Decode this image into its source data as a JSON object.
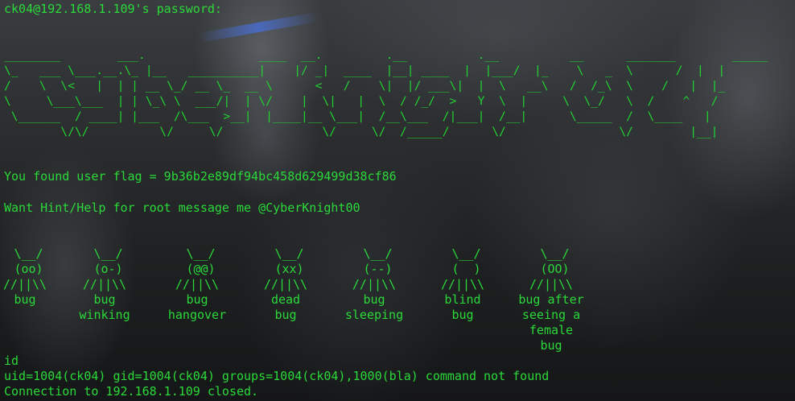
{
  "terminal": {
    "password_prompt": "ck04@192.168.1.109's password:",
    "ascii_banner": "________        ___.                ____  __.         .__          .__          __      _______        _____  \n\\_   ___ \\___.__.\\_ |__   __________|    |/ _|  ____  |__| ____  |  |___/  |_    \\   _  \\      /  |  | \n/    \\  \\<   |  | | __ \\_/ __ \\_  __ \\      <   /    \\|  |/ ___\\|  |  \\   __\\   /  /_\\  \\    /   |  |_\n\\     \\___\\___  | | \\_\\ \\  ___/|  | \\/    |  \\|   |  \\  / /_/  >   Y  \\  |     \\  \\_/   \\  /    ^   /\n \\______  / ____| |___  /\\___  >__|  |____|__ \\___|  /__\\___  /|___|  /__|      \\_____  /  \\____   | \n        \\/\\/          \\/     \\/              \\/     \\/  /_____/      \\/                \\/        |__| ",
    "user_flag_line": "You found user flag = 9b36b2e89df94bc458d629499d38cf86",
    "hint_line": "Want Hint/Help for root message me @CyberKnight00",
    "bugs": [
      {
        "art": " \\__/\n (oo)\n//||\\\\",
        "caption": "bug"
      },
      {
        "art": " \\__/\n (o-)\n//||\\\\",
        "caption": "bug\nwinking"
      },
      {
        "art": " \\__/\n (@@)\n//||\\\\",
        "caption": "bug\nhangover"
      },
      {
        "art": " \\__/\n (xx)\n//||\\\\",
        "caption": "dead\nbug"
      },
      {
        "art": " \\__/\n (--)\n//||\\\\",
        "caption": "bug\nsleeping"
      },
      {
        "art": " \\__/\n (  )\n//||\\\\",
        "caption": "blind\nbug"
      },
      {
        "art": " \\__/\n (OO)\n//||\\\\",
        "caption": "bug after\nseeing a\nfemale\nbug"
      }
    ],
    "id_cmd": "id",
    "id_output": "uid=1004(ck04) gid=1004(ck04) groups=1004(ck04),1000(bla) command not found",
    "closed_line": "Connection to 192.168.1.109 closed.",
    "text_color": "#2bd93a",
    "background_color": "#1b1d1e"
  }
}
